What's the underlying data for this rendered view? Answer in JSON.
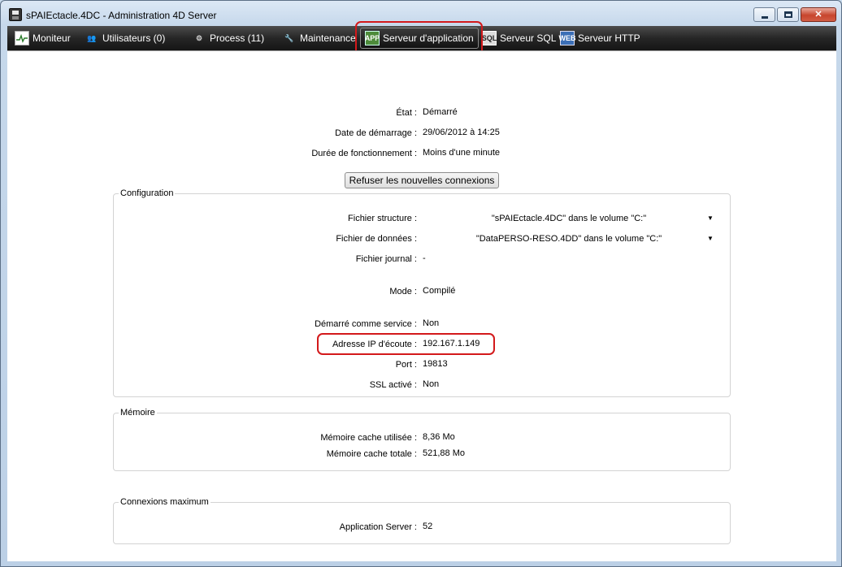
{
  "window": {
    "title": "sPAIEctacle.4DC - Administration 4D Server",
    "icon": "floppy-disk-icon",
    "colors": {
      "highlight": "#d3191b",
      "toolbar_bg": "#1c1c1c"
    }
  },
  "toolbar": {
    "items": [
      {
        "label": "Moniteur",
        "icon": "monitor-icon"
      },
      {
        "label": "Utilisateurs (0)",
        "icon": "users-icon"
      },
      {
        "label": "Process (11)",
        "icon": "gear-icon"
      },
      {
        "label": "Maintenance",
        "icon": "tools-icon"
      },
      {
        "label": "Serveur d'application",
        "icon": "app-server-icon",
        "active": true
      },
      {
        "label": "Serveur SQL",
        "icon": "sql-server-icon"
      },
      {
        "label": "Serveur HTTP",
        "icon": "http-server-icon"
      }
    ]
  },
  "status": {
    "etat": {
      "label": "État :",
      "value": "Démarré"
    },
    "date": {
      "label": "Date de démarrage :",
      "value": "29/06/2012 à 14:25"
    },
    "duree": {
      "label": "Durée de fonctionnement :",
      "value": "Moins d'une minute"
    },
    "button": "Refuser les nouvelles connexions"
  },
  "configuration": {
    "title": "Configuration",
    "structure": {
      "label": "Fichier structure :",
      "value": "\"sPAIEctacle.4DC\" dans le volume \"C:\""
    },
    "donnees": {
      "label": "Fichier de données :",
      "value": "\"DataPERSO-RESO.4DD\" dans le volume \"C:\""
    },
    "journal": {
      "label": "Fichier journal :",
      "value": "-"
    },
    "mode": {
      "label": "Mode :",
      "value": "Compilé"
    },
    "service": {
      "label": "Démarré comme service :",
      "value": "Non"
    },
    "ip": {
      "label": "Adresse IP d'écoute :",
      "value": "192.167.1.149"
    },
    "port": {
      "label": "Port :",
      "value": "19813"
    },
    "ssl": {
      "label": "SSL activé :",
      "value": "Non"
    }
  },
  "memoire": {
    "title": "Mémoire",
    "cache_utilisee": {
      "label": "Mémoire cache utilisée :",
      "value": "8,36 Mo"
    },
    "cache_totale": {
      "label": "Mémoire cache totale :",
      "value": "521,88 Mo"
    }
  },
  "connexions": {
    "title": "Connexions maximum",
    "app_server": {
      "label": "Application Server :",
      "value": "52"
    }
  }
}
